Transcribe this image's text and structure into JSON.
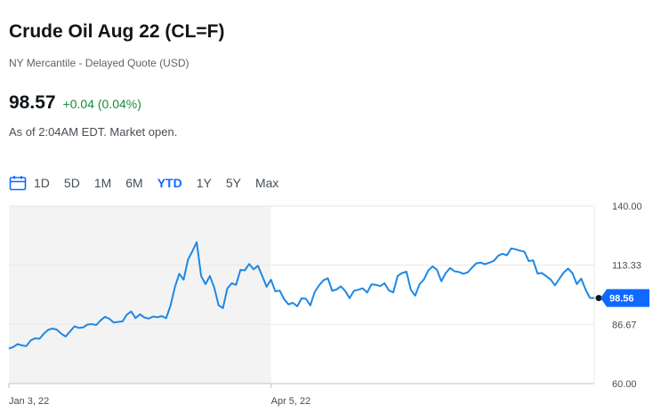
{
  "header": {
    "title": "Crude Oil Aug 22 (CL=F)",
    "exchange": "NY Mercantile - Delayed Quote (USD)",
    "price": "98.57",
    "change": "+0.04 (0.04%)",
    "as_of": "As of 2:04AM EDT. Market open."
  },
  "colors": {
    "line": "#1e88e5",
    "shade": "#f3f3f3",
    "positive": "#1b8a3a",
    "active_range": "#0f69ff",
    "price_tag": "#0f69ff"
  },
  "ranges": {
    "icon": "calendar-icon",
    "items": [
      "1D",
      "5D",
      "1M",
      "6M",
      "YTD",
      "1Y",
      "5Y",
      "Max"
    ],
    "active": "YTD"
  },
  "chart_data": {
    "type": "line",
    "y_ticks": [
      "140.00",
      "113.33",
      "86.67",
      "60.00"
    ],
    "ylim": [
      60,
      140
    ],
    "x_labels": [
      "Jan 3, 22",
      "Apr 5, 22"
    ],
    "x_label_positions": [
      0,
      60
    ],
    "shaded_until_index": 60,
    "current_tag": "98.56",
    "current_value": 98.56,
    "values": [
      75.8,
      76.5,
      77.8,
      77.2,
      76.9,
      79.5,
      80.4,
      80.2,
      82.5,
      84.2,
      84.8,
      84.3,
      82.5,
      81.2,
      83.5,
      85.8,
      85.1,
      85.3,
      86.6,
      86.8,
      86.4,
      88.5,
      90.1,
      89.2,
      87.5,
      87.8,
      88.0,
      91.1,
      92.5,
      89.5,
      91.2,
      89.8,
      89.3,
      90.2,
      89.9,
      90.4,
      89.5,
      95.2,
      103.5,
      109.5,
      106.8,
      115.8,
      119.6,
      123.7,
      108.5,
      104.8,
      108.5,
      103.3,
      95.3,
      94.0,
      102.8,
      105.2,
      104.5,
      111.2,
      111.0,
      113.9,
      111.5,
      113.1,
      108.5,
      103.6,
      106.8,
      101.5,
      101.9,
      98.0,
      95.7,
      96.4,
      94.8,
      98.4,
      98.2,
      95.2,
      101.2,
      104.2,
      106.5,
      107.5,
      101.8,
      102.4,
      103.8,
      101.7,
      98.5,
      101.8,
      102.3,
      102.9,
      101.0,
      104.7,
      104.5,
      103.9,
      105.2,
      101.9,
      101.1,
      108.5,
      109.8,
      110.4,
      102.3,
      99.6,
      104.8,
      106.9,
      110.9,
      112.8,
      111.3,
      106.1,
      109.8,
      112.1,
      110.6,
      110.3,
      109.5,
      110.1,
      112.2,
      114.2,
      114.5,
      113.8,
      114.5,
      115.3,
      117.6,
      118.5,
      117.8,
      120.9,
      120.5,
      119.9,
      119.5,
      115.2,
      115.5,
      109.6,
      109.8,
      108.4,
      106.9,
      104.3,
      107.2,
      110.0,
      111.8,
      109.8,
      104.8,
      107.3,
      102.4,
      98.6,
      98.56
    ]
  }
}
